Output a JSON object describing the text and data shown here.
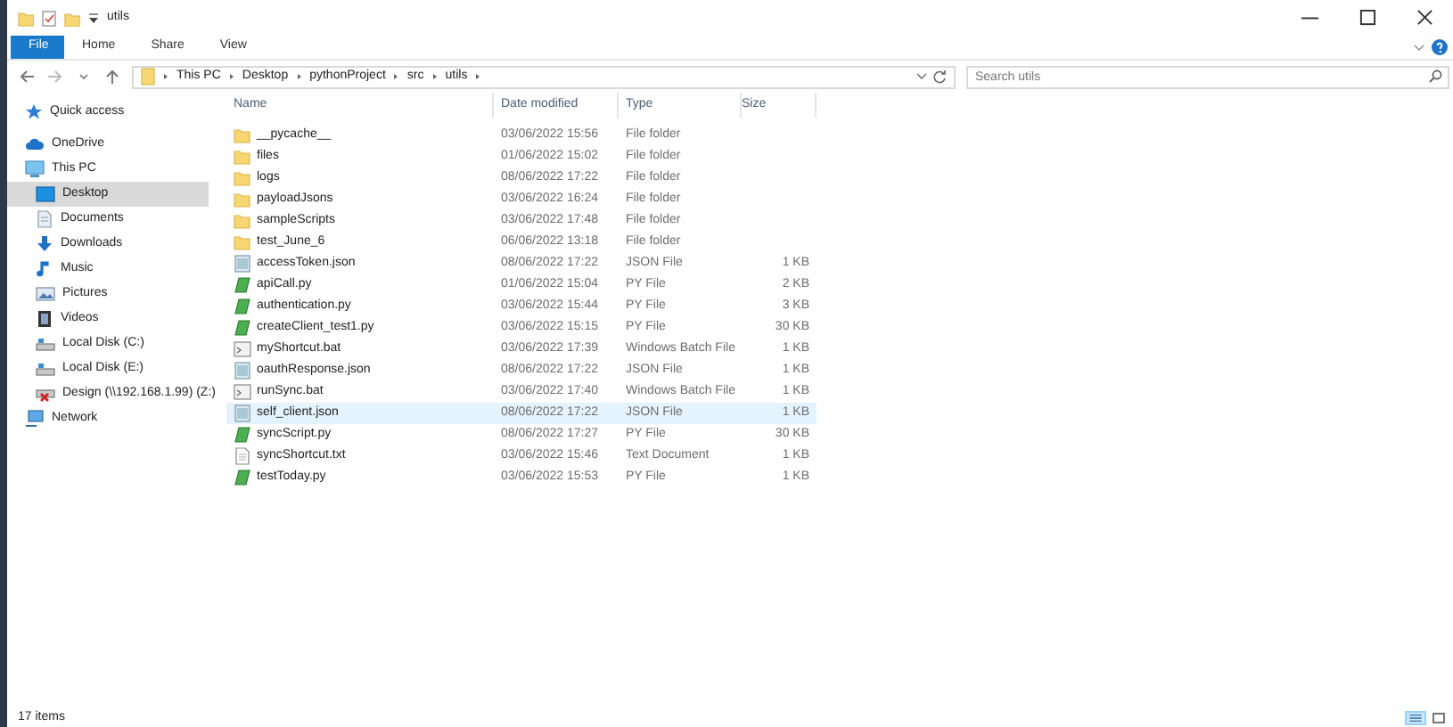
{
  "window": {
    "title": "utils"
  },
  "ribbon_tabs": [
    {
      "label": "File",
      "kind": "file"
    },
    {
      "label": "Home",
      "kind": "tab"
    },
    {
      "label": "Share",
      "kind": "tab"
    },
    {
      "label": "View",
      "kind": "tab"
    }
  ],
  "address_bar": {
    "path": [
      "This PC",
      "Desktop",
      "pythonProject",
      "src",
      "utils"
    ]
  },
  "search": {
    "placeholder": "Search utils"
  },
  "sidebar": {
    "items": [
      {
        "label": "Quick access",
        "kind": "star",
        "selected": false
      },
      {
        "label": "OneDrive",
        "kind": "cloud",
        "selected": false
      },
      {
        "label": "This PC",
        "kind": "pc",
        "selected": false,
        "children": [
          {
            "label": "Desktop",
            "kind": "desktop",
            "selected": true
          },
          {
            "label": "Documents",
            "kind": "documents",
            "selected": false
          },
          {
            "label": "Downloads",
            "kind": "downloads",
            "selected": false
          },
          {
            "label": "Music",
            "kind": "music",
            "selected": false
          },
          {
            "label": "Pictures",
            "kind": "pictures",
            "selected": false
          },
          {
            "label": "Videos",
            "kind": "videos",
            "selected": false
          },
          {
            "label": "Local Disk (C:)",
            "kind": "disk",
            "selected": false
          },
          {
            "label": "Local Disk (E:)",
            "kind": "disk",
            "selected": false
          },
          {
            "label": "Design (\\\\192.168.1.99) (Z:)",
            "kind": "netdrive",
            "selected": false
          }
        ]
      },
      {
        "label": "Network",
        "kind": "network",
        "selected": false
      }
    ]
  },
  "table": {
    "columns": [
      "Name",
      "Date modified",
      "Type",
      "Size"
    ],
    "rows": [
      {
        "kind": "folder",
        "name": "__pycache__",
        "date": "03/06/2022 15:56",
        "type": "File folder",
        "size": "",
        "highlighted": false
      },
      {
        "kind": "folder",
        "name": "files",
        "date": "01/06/2022 15:02",
        "type": "File folder",
        "size": "",
        "highlighted": false
      },
      {
        "kind": "folder",
        "name": "logs",
        "date": "08/06/2022 17:22",
        "type": "File folder",
        "size": "",
        "highlighted": false
      },
      {
        "kind": "folder",
        "name": "payloadJsons",
        "date": "03/06/2022 16:24",
        "type": "File folder",
        "size": "",
        "highlighted": false
      },
      {
        "kind": "folder",
        "name": "sampleScripts",
        "date": "03/06/2022 17:48",
        "type": "File folder",
        "size": "",
        "highlighted": false
      },
      {
        "kind": "folder",
        "name": "test_June_6",
        "date": "06/06/2022 13:18",
        "type": "File folder",
        "size": "",
        "highlighted": false
      },
      {
        "kind": "json",
        "name": "accessToken.json",
        "date": "08/06/2022 17:22",
        "type": "JSON File",
        "size": "1 KB",
        "highlighted": false
      },
      {
        "kind": "py",
        "name": "apiCall.py",
        "date": "01/06/2022 15:04",
        "type": "PY File",
        "size": "2 KB",
        "highlighted": false
      },
      {
        "kind": "py",
        "name": "authentication.py",
        "date": "03/06/2022 15:44",
        "type": "PY File",
        "size": "3 KB",
        "highlighted": false
      },
      {
        "kind": "py",
        "name": "createClient_test1.py",
        "date": "03/06/2022 15:15",
        "type": "PY File",
        "size": "30 KB",
        "highlighted": false
      },
      {
        "kind": "bat",
        "name": "myShortcut.bat",
        "date": "03/06/2022 17:39",
        "type": "Windows Batch File",
        "size": "1 KB",
        "highlighted": false
      },
      {
        "kind": "json",
        "name": "oauthResponse.json",
        "date": "08/06/2022 17:22",
        "type": "JSON File",
        "size": "1 KB",
        "highlighted": false
      },
      {
        "kind": "bat",
        "name": "runSync.bat",
        "date": "03/06/2022 17:40",
        "type": "Windows Batch File",
        "size": "1 KB",
        "highlighted": false
      },
      {
        "kind": "json",
        "name": "self_client.json",
        "date": "08/06/2022 17:22",
        "type": "JSON File",
        "size": "1 KB",
        "highlighted": true
      },
      {
        "kind": "py",
        "name": "syncScript.py",
        "date": "08/06/2022 17:27",
        "type": "PY File",
        "size": "30 KB",
        "highlighted": false
      },
      {
        "kind": "txt",
        "name": "syncShortcut.txt",
        "date": "03/06/2022 15:46",
        "type": "Text Document",
        "size": "1 KB",
        "highlighted": false
      },
      {
        "kind": "py",
        "name": "testToday.py",
        "date": "03/06/2022 15:53",
        "type": "PY File",
        "size": "1 KB",
        "highlighted": false
      }
    ]
  },
  "status_bar": {
    "item_count": "17 items",
    "views": [
      {
        "kind": "details",
        "selected": true
      },
      {
        "kind": "large_icons",
        "selected": false
      }
    ]
  }
}
